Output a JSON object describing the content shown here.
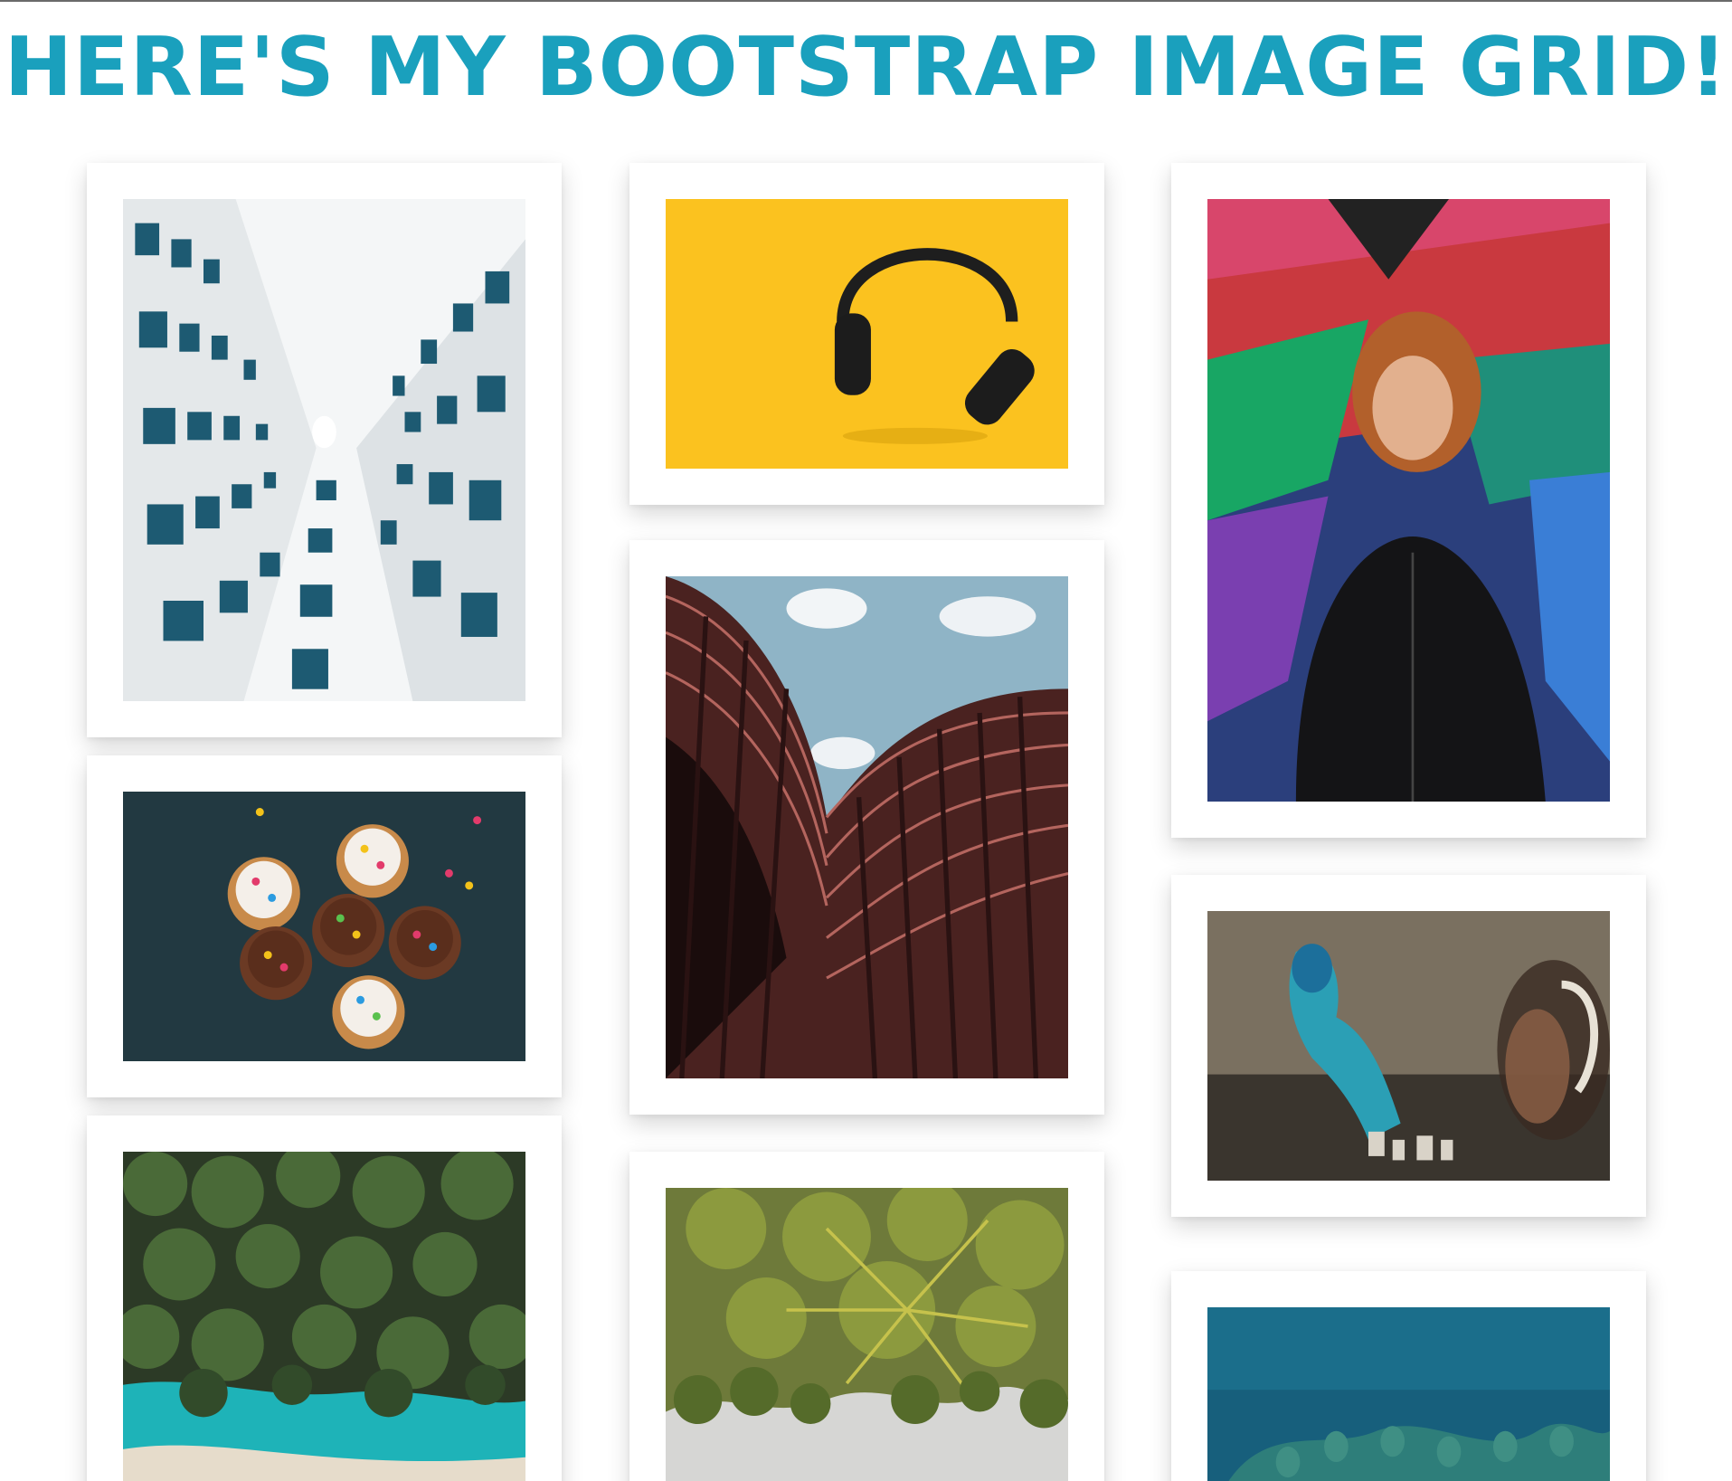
{
  "page": {
    "title": "HERE'S MY BOOTSTRAP IMAGE GRID!",
    "accent_color": "#1aa0bd"
  },
  "gallery": {
    "images": [
      {
        "subject": "white-building-looking-up"
      },
      {
        "subject": "headphones-on-yellow"
      },
      {
        "subject": "woman-in-front-of-graffiti"
      },
      {
        "subject": "cupcakes-on-dark-table"
      },
      {
        "subject": "curved-red-tower"
      },
      {
        "subject": "graffiti-wall-with-blurred-girl"
      },
      {
        "subject": "aerial-palm-beach"
      },
      {
        "subject": "palm-trees-from-below"
      },
      {
        "subject": "aerial-ocean-reef"
      }
    ]
  }
}
